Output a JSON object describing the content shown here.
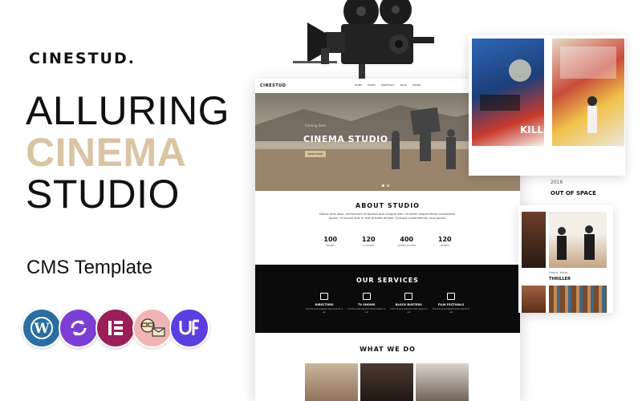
{
  "promo": {
    "brand": "CINESTUD.",
    "headline": [
      "ALLURING",
      "CINEMA",
      "STUDIO"
    ],
    "subtitle": "CMS Template",
    "accent_color": "#d9c4a3",
    "badges": [
      {
        "name": "wordpress-icon",
        "glyph": "W",
        "color": "#2a6fa4"
      },
      {
        "name": "update-sync-icon",
        "glyph": "↻",
        "color": "#7b3fd6"
      },
      {
        "name": "elementor-icon",
        "glyph": "E",
        "color": "#9b1f59"
      },
      {
        "name": "mailchimp-icon",
        "glyph": "✉",
        "color": "#f0b4b4"
      },
      {
        "name": "uf-plugin-icon",
        "glyph": "UF",
        "color": "#5b3ee0"
      }
    ]
  },
  "mockup": {
    "logo": "CINESTUD",
    "menu": [
      "HOME",
      "PAGES",
      "PORTFOLIO",
      "BLOG",
      "SHARE"
    ],
    "hero": {
      "kicker": "Coming Soon",
      "title": "CINEMA STUDIO",
      "button": "READ MORE"
    },
    "about": {
      "title": "ABOUT STUDIO",
      "text": "Donec eros dolor, elementum et facilisis quis congue nibh. Ut lorem aliquet libero consectetur iaculis. Ut lacinia eros in erat gravida tempor. Quisque condimentum urna iaculis.",
      "stats": [
        {
          "value": "100",
          "label": "MOVIES"
        },
        {
          "value": "120",
          "label": "TV SHOWS"
        },
        {
          "value": "400",
          "label": "AWARDS & CREW"
        },
        {
          "value": "120",
          "label": "AWARDS"
        }
      ]
    },
    "services": {
      "title": "OUR SERVICES",
      "items": [
        {
          "name": "DIRECTORS",
          "desc": "Curmus quis sapient lorem ipsum is uel"
        },
        {
          "name": "TV SHOWS",
          "desc": "Curmus quis sapient lorem ipsum is uel"
        },
        {
          "name": "BLOCK BUSTERS",
          "desc": "Curmus quis sapient lorem ipsum is uel"
        },
        {
          "name": "FILM FESTIVALS",
          "desc": "Curmus quis sapient lorem ipsum is uel"
        }
      ]
    },
    "what_we_do": {
      "title": "WHAT WE DO"
    }
  },
  "cards": {
    "top": {
      "year": "2016",
      "title": "OUT OF SPACE"
    },
    "bottom": {
      "meta": "Drama, Action",
      "title": "THRILLER"
    }
  }
}
